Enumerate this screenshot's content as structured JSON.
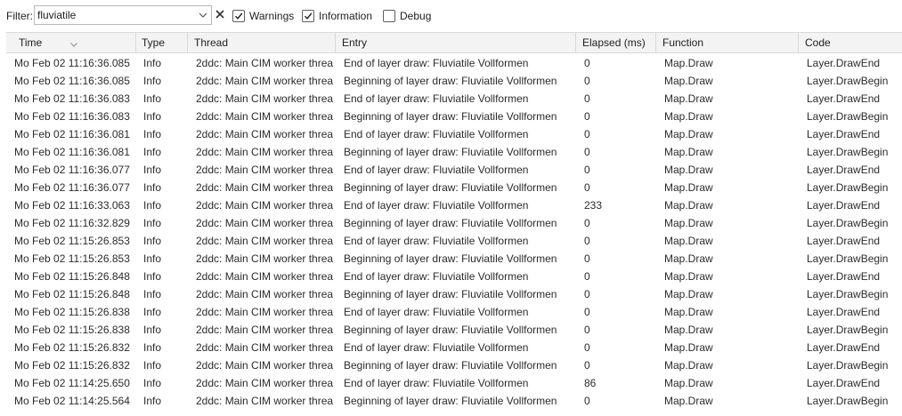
{
  "filter": {
    "label": "Filter:",
    "value": "fluviatile",
    "clear_icon": "close-icon",
    "dropdown_icon": "chevron-down-icon"
  },
  "checkboxes": [
    {
      "label": "Warnings",
      "checked": true
    },
    {
      "label": "Information",
      "checked": true
    },
    {
      "label": "Debug",
      "checked": false
    }
  ],
  "columns": [
    "Time",
    "Type",
    "Thread",
    "Entry",
    "Elapsed (ms)",
    "Function",
    "Code"
  ],
  "sorted_column": "Time",
  "rows": [
    [
      "Mo Feb 02 11:16:36.085",
      "Info",
      "2ddc: Main CIM worker threa",
      "End of layer draw: Fluviatile Vollformen",
      "0",
      "Map.Draw",
      "Layer.DrawEnd"
    ],
    [
      "Mo Feb 02 11:16:36.085",
      "Info",
      "2ddc: Main CIM worker threa",
      "Beginning of layer draw: Fluviatile Vollformen",
      "0",
      "Map.Draw",
      "Layer.DrawBegin"
    ],
    [
      "Mo Feb 02 11:16:36.083",
      "Info",
      "2ddc: Main CIM worker threa",
      "End of layer draw: Fluviatile Vollformen",
      "0",
      "Map.Draw",
      "Layer.DrawEnd"
    ],
    [
      "Mo Feb 02 11:16:36.083",
      "Info",
      "2ddc: Main CIM worker threa",
      "Beginning of layer draw: Fluviatile Vollformen",
      "0",
      "Map.Draw",
      "Layer.DrawBegin"
    ],
    [
      "Mo Feb 02 11:16:36.081",
      "Info",
      "2ddc: Main CIM worker threa",
      "End of layer draw: Fluviatile Vollformen",
      "0",
      "Map.Draw",
      "Layer.DrawEnd"
    ],
    [
      "Mo Feb 02 11:16:36.081",
      "Info",
      "2ddc: Main CIM worker threa",
      "Beginning of layer draw: Fluviatile Vollformen",
      "0",
      "Map.Draw",
      "Layer.DrawBegin"
    ],
    [
      "Mo Feb 02 11:16:36.077",
      "Info",
      "2ddc: Main CIM worker threa",
      "End of layer draw: Fluviatile Vollformen",
      "0",
      "Map.Draw",
      "Layer.DrawEnd"
    ],
    [
      "Mo Feb 02 11:16:36.077",
      "Info",
      "2ddc: Main CIM worker threa",
      "Beginning of layer draw: Fluviatile Vollformen",
      "0",
      "Map.Draw",
      "Layer.DrawBegin"
    ],
    [
      "Mo Feb 02 11:16:33.063",
      "Info",
      "2ddc: Main CIM worker threa",
      "End of layer draw: Fluviatile Vollformen",
      "233",
      "Map.Draw",
      "Layer.DrawEnd"
    ],
    [
      "Mo Feb 02 11:16:32.829",
      "Info",
      "2ddc: Main CIM worker threa",
      "Beginning of layer draw: Fluviatile Vollformen",
      "0",
      "Map.Draw",
      "Layer.DrawBegin"
    ],
    [
      "Mo Feb 02 11:15:26.853",
      "Info",
      "2ddc: Main CIM worker threa",
      "End of layer draw: Fluviatile Vollformen",
      "0",
      "Map.Draw",
      "Layer.DrawEnd"
    ],
    [
      "Mo Feb 02 11:15:26.853",
      "Info",
      "2ddc: Main CIM worker threa",
      "Beginning of layer draw: Fluviatile Vollformen",
      "0",
      "Map.Draw",
      "Layer.DrawBegin"
    ],
    [
      "Mo Feb 02 11:15:26.848",
      "Info",
      "2ddc: Main CIM worker threa",
      "End of layer draw: Fluviatile Vollformen",
      "0",
      "Map.Draw",
      "Layer.DrawEnd"
    ],
    [
      "Mo Feb 02 11:15:26.848",
      "Info",
      "2ddc: Main CIM worker threa",
      "Beginning of layer draw: Fluviatile Vollformen",
      "0",
      "Map.Draw",
      "Layer.DrawBegin"
    ],
    [
      "Mo Feb 02 11:15:26.838",
      "Info",
      "2ddc: Main CIM worker threa",
      "End of layer draw: Fluviatile Vollformen",
      "0",
      "Map.Draw",
      "Layer.DrawEnd"
    ],
    [
      "Mo Feb 02 11:15:26.838",
      "Info",
      "2ddc: Main CIM worker threa",
      "Beginning of layer draw: Fluviatile Vollformen",
      "0",
      "Map.Draw",
      "Layer.DrawBegin"
    ],
    [
      "Mo Feb 02 11:15:26.832",
      "Info",
      "2ddc: Main CIM worker threa",
      "End of layer draw: Fluviatile Vollformen",
      "0",
      "Map.Draw",
      "Layer.DrawEnd"
    ],
    [
      "Mo Feb 02 11:15:26.832",
      "Info",
      "2ddc: Main CIM worker threa",
      "Beginning of layer draw: Fluviatile Vollformen",
      "0",
      "Map.Draw",
      "Layer.DrawBegin"
    ],
    [
      "Mo Feb 02 11:14:25.650",
      "Info",
      "2ddc: Main CIM worker threa",
      "End of layer draw: Fluviatile Vollformen",
      "86",
      "Map.Draw",
      "Layer.DrawEnd"
    ],
    [
      "Mo Feb 02 11:14:25.564",
      "Info",
      "2ddc: Main CIM worker threa",
      "Beginning of layer draw: Fluviatile Vollformen",
      "0",
      "Map.Draw",
      "Layer.DrawBegin"
    ]
  ]
}
